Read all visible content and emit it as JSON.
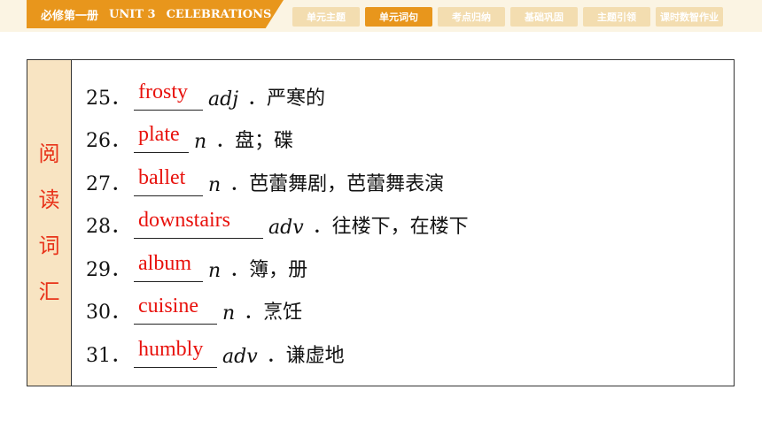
{
  "header": {
    "book": "必修第一册",
    "unit": "UNIT 3",
    "unit_title": "CELEBRATIONS"
  },
  "tabs": [
    {
      "label": "单元主题",
      "active": false
    },
    {
      "label": "单元词句",
      "active": true
    },
    {
      "label": "考点归纳",
      "active": false
    },
    {
      "label": "基础巩固",
      "active": false
    },
    {
      "label": "主题引领",
      "active": false
    },
    {
      "label": "课时数智作业",
      "active": false
    }
  ],
  "side_label": [
    "阅",
    "读",
    "词",
    "汇"
  ],
  "colors": {
    "accent": "#e8961c",
    "answer": "#e8120d",
    "side_text": "#e8331a"
  },
  "entries": [
    {
      "num": "25．",
      "answer": "frosty",
      "pos": "adj",
      "def": "．严寒的"
    },
    {
      "num": "26．",
      "answer": "plate",
      "pos": "n",
      "def": "．盘；碟"
    },
    {
      "num": "27．",
      "answer": "ballet",
      "pos": "n",
      "def": "．芭蕾舞剧，芭蕾舞表演"
    },
    {
      "num": "28．",
      "answer": "downstairs",
      "pos": "adv",
      "def": "．往楼下，在楼下"
    },
    {
      "num": "29．",
      "answer": "album",
      "pos": "n",
      "def": "．簿，册"
    },
    {
      "num": "30．",
      "answer": "cuisine",
      "pos": "n",
      "def": "．烹饪"
    },
    {
      "num": "31．",
      "answer": "humbly",
      "pos": "adv",
      "def": "．谦虚地"
    }
  ]
}
